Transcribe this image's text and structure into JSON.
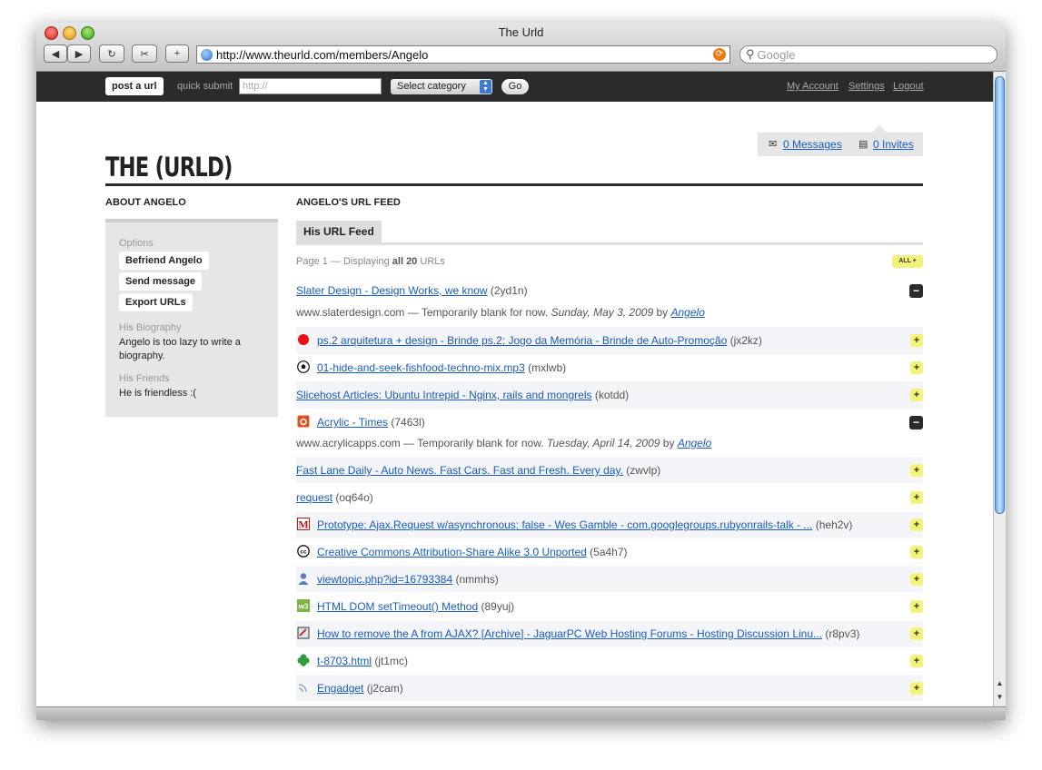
{
  "window": {
    "title": "The Urld"
  },
  "toolbar": {
    "url": "http://www.theurld.com/members/Angelo",
    "search_placeholder": "Google"
  },
  "topbar": {
    "post_label": "post a url",
    "quick_submit_label": "quick submit",
    "quick_submit_placeholder": "http://",
    "category_label": "Select category",
    "go_label": "Go",
    "my_account": "My Account",
    "settings": "Settings",
    "logout": "Logout"
  },
  "header": {
    "logo": "THE (URLD)",
    "messages": "0 Messages",
    "invites": "0 Invites"
  },
  "sidebar": {
    "heading": "ABOUT ANGELO",
    "options_label": "Options",
    "buttons": [
      "Befriend Angelo",
      "Send message",
      "Export URLs"
    ],
    "bio_label": "His Biography",
    "bio_text": "Angelo is too lazy to write a biography.",
    "friends_label": "His Friends",
    "friends_text": "He is friendless :("
  },
  "feed": {
    "heading": "ANGELO'S URL FEED",
    "tab": "His URL Feed",
    "page_prefix": "Page 1 — Displaying ",
    "page_bold": "all 20",
    "page_suffix": " URLs",
    "all_button": "ALL +",
    "items": [
      {
        "title": "Slater Design - Design Works, we know",
        "code": "(2yd1n)",
        "icon": "none",
        "expanded": true,
        "domain": "www.slaterdesign.com",
        "desc": "Temporarily blank for now.",
        "date": "Sunday, May 3, 2009",
        "by": "by",
        "user": "Angelo"
      },
      {
        "title": "ps.2 arquitetura + design - Brinde ps.2: Jogo da Memória - Brinde de Auto-Promoção",
        "code": "(jx2kz)",
        "icon": "red-dot-icon"
      },
      {
        "title": "01-hide-and-seek-fishfood-techno-mix.mp3",
        "code": "(mxlwb)",
        "icon": "soccer-ball-icon"
      },
      {
        "title": "Slicehost Articles: Ubuntu Intrepid - Nginx, rails and mongrels",
        "code": "(kotdd)",
        "icon": "none"
      },
      {
        "title": "Acrylic - Times",
        "code": "(7463l)",
        "icon": "acrylic-icon",
        "expanded": true,
        "domain": "www.acrylicapps.com",
        "desc": "Temporarily blank for now.",
        "date": "Tuesday, April 14, 2009",
        "by": "by",
        "user": "Angelo"
      },
      {
        "title": "Fast Lane Daily - Auto News. Fast Cars. Fast and Fresh. Every day.",
        "code": "(zwvlp)",
        "icon": "none"
      },
      {
        "title": "request",
        "code": "(oq64o)",
        "icon": "none"
      },
      {
        "title": "Prototype: Ajax.Request w/asynchronous: false - Wes Gamble - com.googlegroups.rubyonrails-talk - ...",
        "code": "(heh2v)",
        "icon": "gmail-icon"
      },
      {
        "title": "Creative Commons Attribution-Share Alike 3.0 Unported",
        "code": "(5a4h7)",
        "icon": "cc-icon"
      },
      {
        "title": "viewtopic.php?id=16793384",
        "code": "(nmmhs)",
        "icon": "user-icon"
      },
      {
        "title": "HTML DOM setTimeout() Method",
        "code": "(89yuj)",
        "icon": "w3-icon"
      },
      {
        "title": "How to remove the A from AJAX? [Archive] - JaguarPC Web Hosting Forums - Hosting Discussion Linu...",
        "code": "(r8pv3)",
        "icon": "forum-icon"
      },
      {
        "title": "t-8703.html",
        "code": "(jt1mc)",
        "icon": "clover-icon"
      },
      {
        "title": "Engadget",
        "code": "(j2cam)",
        "icon": "feed-icon"
      }
    ]
  },
  "colors": {
    "link": "#1a5bc4",
    "topbar": "#2b2b2b",
    "add": "#f3f37a"
  }
}
